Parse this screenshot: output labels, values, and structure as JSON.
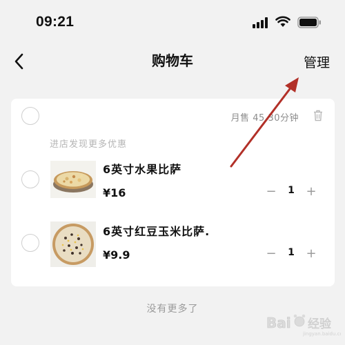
{
  "status_bar": {
    "time": "09:21"
  },
  "nav": {
    "title": "购物车",
    "manage_label": "管理"
  },
  "shop": {
    "meta_text": "月售 45 30分钟",
    "promo_text": "进店发现更多优惠"
  },
  "items": [
    {
      "name": "6英寸水果比萨",
      "price": "¥16",
      "quantity": "1"
    },
    {
      "name": "6英寸红豆玉米比萨.",
      "price": "¥9.9",
      "quantity": "1"
    }
  ],
  "stepper": {
    "minus_label": "−",
    "plus_label": "+"
  },
  "footer": {
    "no_more_text": "没有更多了"
  },
  "colors": {
    "annotation_arrow": "#b23028",
    "card_bg": "#ffffff",
    "page_bg": "#f2f2f2"
  },
  "icons": [
    "signal-icon",
    "wifi-icon",
    "battery-icon",
    "back-icon",
    "trash-icon"
  ]
}
